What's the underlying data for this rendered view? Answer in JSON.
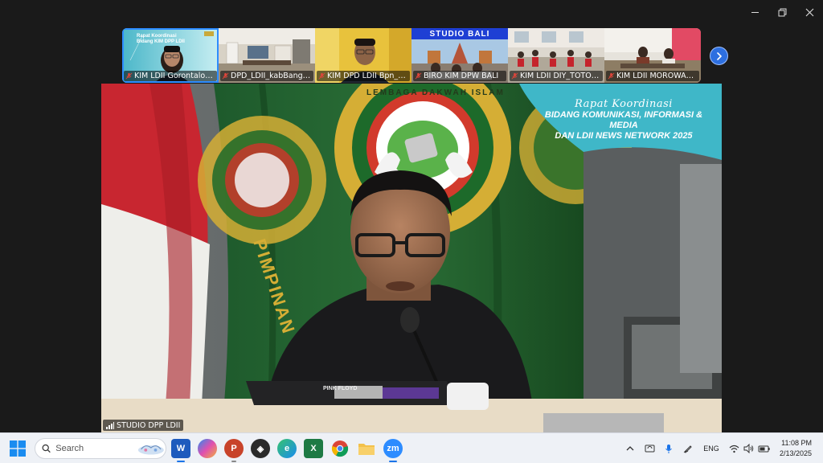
{
  "window": {
    "controls": [
      "minimize",
      "restore",
      "close"
    ]
  },
  "participants": [
    {
      "name": "KIM LDII Gorontalo_A...",
      "muted": true
    },
    {
      "name": "DPD_LDII_kabBanggai",
      "muted": true
    },
    {
      "name": "KIM DPD LDII Bpn_Tio",
      "muted": true
    },
    {
      "name": "BIRO KIM DPW BALI",
      "muted": true,
      "header": "STUDIO BALI"
    },
    {
      "name": "KIM LDII DIY_TOTOK P...",
      "muted": true
    },
    {
      "name": "KIM LDII MOROWALI...",
      "muted": true
    }
  ],
  "tile1_overlay": {
    "line1": "Rapat Koordinasi",
    "line2": "Bidang KIM DPP LDII"
  },
  "main_video": {
    "speaker": "STUDIO DPP LDII",
    "banner": {
      "title": "Rapat Koordinasi",
      "line1": "BIDANG KOMUNIKASI, INFORMASI & MEDIA",
      "line2": "DAN LDII NEWS NETWORK 2025"
    },
    "emblem_text": "LEMBAGA DAKWAH ISLAM",
    "flag_text": "PIMPINAN",
    "laptop_sticker": "PINK FLOYD"
  },
  "taskbar": {
    "search_placeholder": "Search",
    "apps": [
      "word-icon",
      "copilot-icon",
      "powerpoint-icon",
      "bird-icon",
      "edge-icon",
      "excel-icon",
      "chrome-icon",
      "folder-icon",
      "zoom-icon"
    ],
    "zoom_label": "zm",
    "language": "ENG",
    "time": "11:08 PM",
    "date": "2/13/2025"
  },
  "colors": {
    "zoom_blue": "#2d8cff",
    "taskbar": "#eef1f6",
    "flag_green": "#1f5a2e",
    "emblem_gold": "#d8b23a",
    "banner_teal": "#3fb7c8"
  }
}
